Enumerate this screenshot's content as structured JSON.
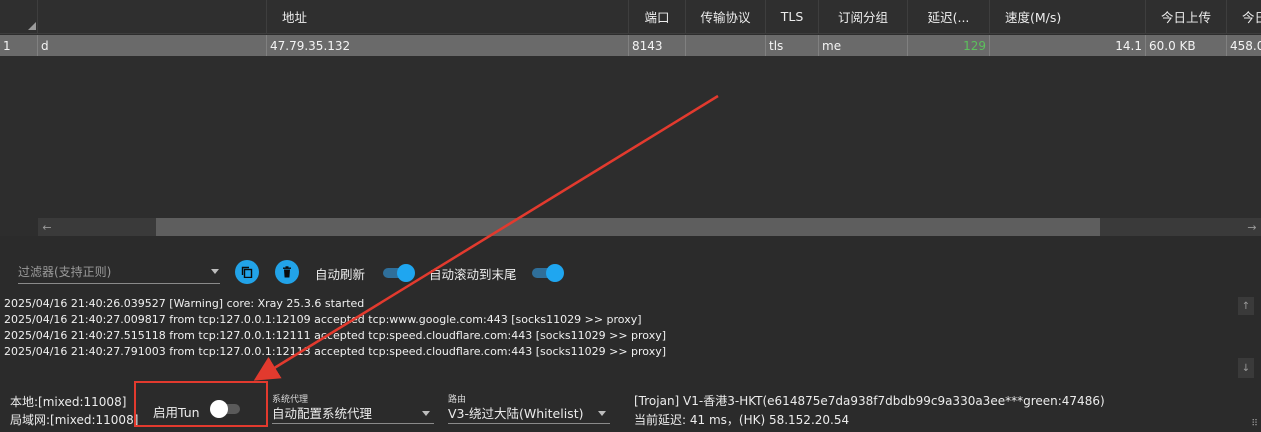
{
  "table": {
    "headers": {
      "address": "地址",
      "port": "端口",
      "transport": "传输协议",
      "tls": "TLS",
      "subgroup": "订阅分组",
      "latency": "延迟(...",
      "speed": "速度(M/s)",
      "upload_today": "今日上传",
      "download_today": "今日"
    },
    "row": {
      "index": "1",
      "remarks": "d",
      "address": "47.79.35.132",
      "port": "8143",
      "transport": "",
      "tls": "tls",
      "subgroup": "me",
      "latency": "129",
      "speed": "14.1",
      "upload_today": "60.0 KB",
      "download_today": "458.0"
    }
  },
  "toolbar": {
    "filter_placeholder": "过滤器(支持正则)",
    "auto_refresh_label": "自动刷新",
    "auto_refresh_on": true,
    "auto_scroll_label": "自动滚动到末尾",
    "auto_scroll_on": true
  },
  "log": [
    "2025/04/16 21:40:26.039527 [Warning] core: Xray 25.3.6 started",
    "2025/04/16 21:40:27.009817 from tcp:127.0.0.1:12109 accepted tcp:www.google.com:443 [socks11029 >> proxy]",
    "2025/04/16 21:40:27.515118 from tcp:127.0.0.1:12111 accepted tcp:speed.cloudflare.com:443 [socks11029 >> proxy]",
    "2025/04/16 21:40:27.791003 from tcp:127.0.0.1:12113 accepted tcp:speed.cloudflare.com:443 [socks11029 >> proxy]"
  ],
  "status": {
    "local": "本地:[mixed:11008]",
    "lan": "局域网:[mixed:11008]",
    "tun_label": "启用Tun",
    "tun_on": false,
    "system_proxy_caption": "系统代理",
    "system_proxy_value": "自动配置系统代理",
    "routing_caption": "路由",
    "routing_value": "V3-绕过大陆(Whitelist)",
    "server_line": "[Trojan] V1-香港3-HKT(e614875e7da938f7dbdb99c9a330a3ee***green:47486)",
    "latency_line": "当前延迟: 41 ms，(HK) 58.152.20.54"
  },
  "colors": {
    "accent": "#22a3e8",
    "latency_good": "#5cc05c",
    "annotation": "#e23a2e"
  }
}
